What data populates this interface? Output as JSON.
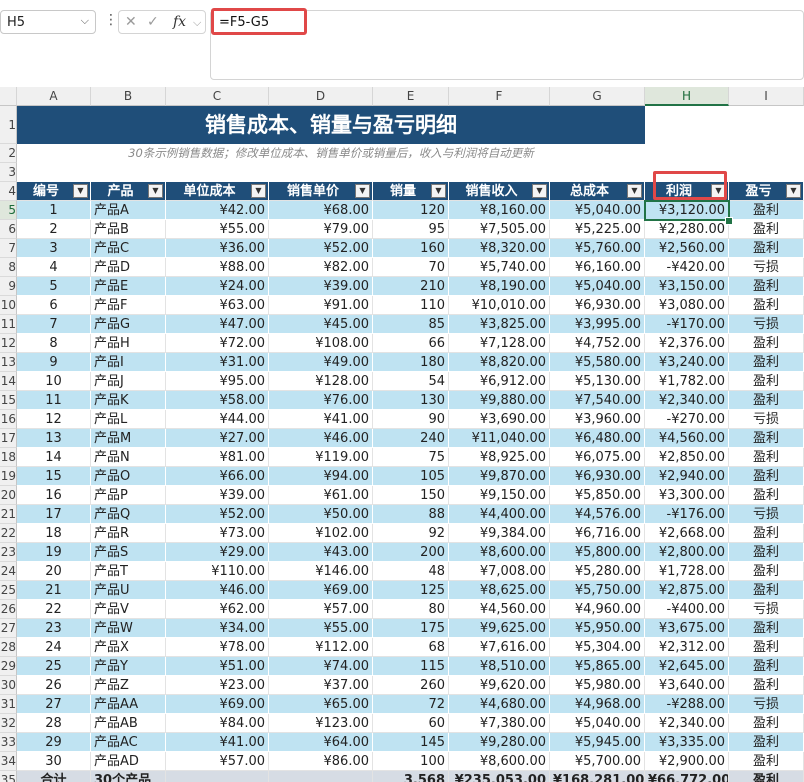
{
  "name_box": {
    "value": "H5"
  },
  "formula_bar": {
    "cancel_glyph": "✕",
    "enter_glyph": "✓",
    "fx_label": "fx",
    "value": "=F5-G5"
  },
  "columns": [
    "A",
    "B",
    "C",
    "D",
    "E",
    "F",
    "G",
    "H",
    "I"
  ],
  "selected_column": "H",
  "row_numbers": [
    "1",
    "2",
    "3",
    "4",
    "5",
    "6",
    "7",
    "8",
    "9",
    "10",
    "11",
    "12",
    "13",
    "14",
    "15",
    "16",
    "17",
    "18",
    "19",
    "20",
    "21",
    "22",
    "23",
    "24",
    "25",
    "26",
    "27",
    "28",
    "29",
    "30",
    "31",
    "32",
    "33",
    "34",
    "35"
  ],
  "selected_row": "5",
  "sheet": {
    "title": "销售成本、销量与盈亏明细",
    "subtitle": "30条示例销售数据；修改单位成本、销售单价或销量后，收入与利润将自动更新",
    "headers": [
      "编号",
      "产品",
      "单位成本",
      "销售单价",
      "销量",
      "销售收入",
      "总成本",
      "利润",
      "盈亏"
    ],
    "rows": [
      [
        "1",
        "产品A",
        "¥42.00",
        "¥68.00",
        "120",
        "¥8,160.00",
        "¥5,040.00",
        "¥3,120.00",
        "盈利"
      ],
      [
        "2",
        "产品B",
        "¥55.00",
        "¥79.00",
        "95",
        "¥7,505.00",
        "¥5,225.00",
        "¥2,280.00",
        "盈利"
      ],
      [
        "3",
        "产品C",
        "¥36.00",
        "¥52.00",
        "160",
        "¥8,320.00",
        "¥5,760.00",
        "¥2,560.00",
        "盈利"
      ],
      [
        "4",
        "产品D",
        "¥88.00",
        "¥82.00",
        "70",
        "¥5,740.00",
        "¥6,160.00",
        "-¥420.00",
        "亏损"
      ],
      [
        "5",
        "产品E",
        "¥24.00",
        "¥39.00",
        "210",
        "¥8,190.00",
        "¥5,040.00",
        "¥3,150.00",
        "盈利"
      ],
      [
        "6",
        "产品F",
        "¥63.00",
        "¥91.00",
        "110",
        "¥10,010.00",
        "¥6,930.00",
        "¥3,080.00",
        "盈利"
      ],
      [
        "7",
        "产品G",
        "¥47.00",
        "¥45.00",
        "85",
        "¥3,825.00",
        "¥3,995.00",
        "-¥170.00",
        "亏损"
      ],
      [
        "8",
        "产品H",
        "¥72.00",
        "¥108.00",
        "66",
        "¥7,128.00",
        "¥4,752.00",
        "¥2,376.00",
        "盈利"
      ],
      [
        "9",
        "产品I",
        "¥31.00",
        "¥49.00",
        "180",
        "¥8,820.00",
        "¥5,580.00",
        "¥3,240.00",
        "盈利"
      ],
      [
        "10",
        "产品J",
        "¥95.00",
        "¥128.00",
        "54",
        "¥6,912.00",
        "¥5,130.00",
        "¥1,782.00",
        "盈利"
      ],
      [
        "11",
        "产品K",
        "¥58.00",
        "¥76.00",
        "130",
        "¥9,880.00",
        "¥7,540.00",
        "¥2,340.00",
        "盈利"
      ],
      [
        "12",
        "产品L",
        "¥44.00",
        "¥41.00",
        "90",
        "¥3,690.00",
        "¥3,960.00",
        "-¥270.00",
        "亏损"
      ],
      [
        "13",
        "产品M",
        "¥27.00",
        "¥46.00",
        "240",
        "¥11,040.00",
        "¥6,480.00",
        "¥4,560.00",
        "盈利"
      ],
      [
        "14",
        "产品N",
        "¥81.00",
        "¥119.00",
        "75",
        "¥8,925.00",
        "¥6,075.00",
        "¥2,850.00",
        "盈利"
      ],
      [
        "15",
        "产品O",
        "¥66.00",
        "¥94.00",
        "105",
        "¥9,870.00",
        "¥6,930.00",
        "¥2,940.00",
        "盈利"
      ],
      [
        "16",
        "产品P",
        "¥39.00",
        "¥61.00",
        "150",
        "¥9,150.00",
        "¥5,850.00",
        "¥3,300.00",
        "盈利"
      ],
      [
        "17",
        "产品Q",
        "¥52.00",
        "¥50.00",
        "88",
        "¥4,400.00",
        "¥4,576.00",
        "-¥176.00",
        "亏损"
      ],
      [
        "18",
        "产品R",
        "¥73.00",
        "¥102.00",
        "92",
        "¥9,384.00",
        "¥6,716.00",
        "¥2,668.00",
        "盈利"
      ],
      [
        "19",
        "产品S",
        "¥29.00",
        "¥43.00",
        "200",
        "¥8,600.00",
        "¥5,800.00",
        "¥2,800.00",
        "盈利"
      ],
      [
        "20",
        "产品T",
        "¥110.00",
        "¥146.00",
        "48",
        "¥7,008.00",
        "¥5,280.00",
        "¥1,728.00",
        "盈利"
      ],
      [
        "21",
        "产品U",
        "¥46.00",
        "¥69.00",
        "125",
        "¥8,625.00",
        "¥5,750.00",
        "¥2,875.00",
        "盈利"
      ],
      [
        "22",
        "产品V",
        "¥62.00",
        "¥57.00",
        "80",
        "¥4,560.00",
        "¥4,960.00",
        "-¥400.00",
        "亏损"
      ],
      [
        "23",
        "产品W",
        "¥34.00",
        "¥55.00",
        "175",
        "¥9,625.00",
        "¥5,950.00",
        "¥3,675.00",
        "盈利"
      ],
      [
        "24",
        "产品X",
        "¥78.00",
        "¥112.00",
        "68",
        "¥7,616.00",
        "¥5,304.00",
        "¥2,312.00",
        "盈利"
      ],
      [
        "25",
        "产品Y",
        "¥51.00",
        "¥74.00",
        "115",
        "¥8,510.00",
        "¥5,865.00",
        "¥2,645.00",
        "盈利"
      ],
      [
        "26",
        "产品Z",
        "¥23.00",
        "¥37.00",
        "260",
        "¥9,620.00",
        "¥5,980.00",
        "¥3,640.00",
        "盈利"
      ],
      [
        "27",
        "产品AA",
        "¥69.00",
        "¥65.00",
        "72",
        "¥4,680.00",
        "¥4,968.00",
        "-¥288.00",
        "亏损"
      ],
      [
        "28",
        "产品AB",
        "¥84.00",
        "¥123.00",
        "60",
        "¥7,380.00",
        "¥5,040.00",
        "¥2,340.00",
        "盈利"
      ],
      [
        "29",
        "产品AC",
        "¥41.00",
        "¥64.00",
        "145",
        "¥9,280.00",
        "¥5,945.00",
        "¥3,335.00",
        "盈利"
      ],
      [
        "30",
        "产品AD",
        "¥57.00",
        "¥86.00",
        "100",
        "¥8,600.00",
        "¥5,700.00",
        "¥2,900.00",
        "盈利"
      ]
    ],
    "total_row": [
      "合计",
      "30个产品",
      "",
      "",
      "3,568",
      "¥235,053.00",
      "¥168,281.00",
      "¥66,772.00",
      "盈利"
    ]
  },
  "colors": {
    "header_fill": "#1f4e79",
    "band_fill": "#bfe3f2",
    "highlight": "#e04848",
    "selection": "#217346"
  }
}
